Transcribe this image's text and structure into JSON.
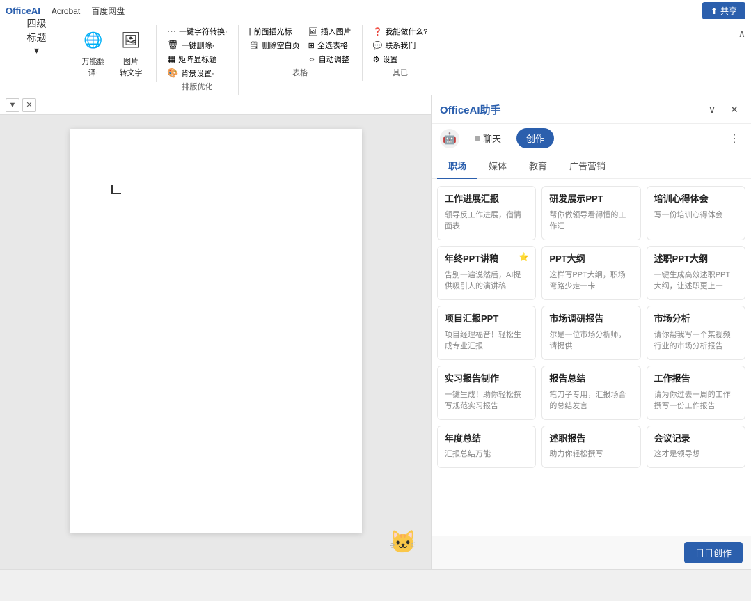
{
  "topbar": {
    "logo": "OfficeAI",
    "menu_items": [
      "Acrobat",
      "百度网盘"
    ],
    "share_label": "共享",
    "heading_selector": "四级标题"
  },
  "ribbon": {
    "sections": [
      {
        "id": "translate",
        "label": "",
        "items": [
          {
            "id": "translate-btn",
            "icon": "🌐",
            "label": "万能翻\n译·",
            "has_dropdown": true
          },
          {
            "id": "img-to-text",
            "icon": "🖼",
            "label": "图片\n转文字"
          }
        ]
      },
      {
        "id": "format",
        "label": "排版优化",
        "items": [
          {
            "id": "one-key-symbol",
            "label": "一键字符转换·"
          },
          {
            "id": "one-key-delete",
            "label": "一键删除·"
          },
          {
            "id": "tile-title",
            "label": "矩阵显标题"
          },
          {
            "id": "bg-setting",
            "label": "背景设置·"
          }
        ]
      },
      {
        "id": "table",
        "label": "表格",
        "items": [
          {
            "id": "insert-cursor",
            "label": "前面插光标"
          },
          {
            "id": "delete-blank-page",
            "label": "删除空白页"
          },
          {
            "id": "insert-image",
            "label": "插入图片"
          },
          {
            "id": "select-all-table",
            "label": "全选表格"
          },
          {
            "id": "auto-adjust",
            "label": "自动调整"
          }
        ]
      },
      {
        "id": "help",
        "label": "其已",
        "items": [
          {
            "id": "what-can-i-do",
            "label": "我能做什么?"
          },
          {
            "id": "contact-us",
            "label": "联系我们"
          },
          {
            "id": "settings",
            "label": "设置"
          }
        ]
      }
    ]
  },
  "ai_panel": {
    "title": "OfficeAI助手",
    "tabs": [
      {
        "id": "chat",
        "label": "聊天",
        "active": false
      },
      {
        "id": "create",
        "label": "创作",
        "active": true
      }
    ],
    "categories": [
      {
        "id": "workplace",
        "label": "职场",
        "active": true
      },
      {
        "id": "media",
        "label": "媒体"
      },
      {
        "id": "education",
        "label": "教育"
      },
      {
        "id": "advertising",
        "label": "广告营销"
      }
    ],
    "cards": [
      {
        "id": "work-progress",
        "title": "工作进展汇报",
        "desc": "领导反工作进展，宿情面表",
        "icon": "📊"
      },
      {
        "id": "rd-ppt",
        "title": "研发展示PPT",
        "desc": "帮你做领导看得懂的工作汇",
        "icon": "💡"
      },
      {
        "id": "training-summary",
        "title": "培训心得体会",
        "desc": "写一份培训心得体会",
        "icon": "📝"
      },
      {
        "id": "year-end-ppt",
        "title": "年终PPT讲稿",
        "desc": "告别一遍说然后，AI提供吸引人的演讲稿",
        "icon": "🎤"
      },
      {
        "id": "ppt-outline",
        "title": "PPT大纲",
        "desc": "这样写PPT大纲，职场弯路少走一卡",
        "icon": "📋"
      },
      {
        "id": "resume-ppt",
        "title": "述职PPT大纲",
        "desc": "一键生成高效述职PPT大纲，让述职更上一",
        "icon": "🎯"
      },
      {
        "id": "project-report-ppt",
        "title": "项目汇报PPT",
        "desc": "项目经理福音！轻松生成专业汇报",
        "icon": "📈"
      },
      {
        "id": "market-survey",
        "title": "市场调研报告",
        "desc": "尔是一位市场分析师，请提供",
        "icon": "🔍"
      },
      {
        "id": "market-analysis",
        "title": "市场分析",
        "desc": "请你帮我写一个某视频行业的市场分析报告",
        "icon": "📉"
      },
      {
        "id": "internship-report",
        "title": "实习报告制作",
        "desc": "一键生成！助你轻松撰写规范实习报告",
        "icon": "📄"
      },
      {
        "id": "report-summary",
        "title": "报告总结",
        "desc": "笔刀子专用，汇报场合的总结发言",
        "icon": "✍"
      },
      {
        "id": "work-report",
        "title": "工作报告",
        "desc": "请为你过去一周的工作撰写一份工作报告",
        "icon": "🗒"
      },
      {
        "id": "annual-summary",
        "title": "年度总结",
        "desc": "汇报总结万能",
        "icon": "🌟"
      },
      {
        "id": "performance-report",
        "title": "述职报告",
        "desc": "助力你轻松撰写",
        "icon": "📑"
      },
      {
        "id": "meeting-minutes",
        "title": "会议记录",
        "desc": "这才是领导想",
        "icon": "📓"
      }
    ],
    "bottom_btn": "目目创作",
    "char_emoji": "🐱"
  },
  "floating_bar": {
    "collapse_icon": "▼",
    "close_icon": "✕"
  },
  "status_bar": {
    "text": ""
  }
}
